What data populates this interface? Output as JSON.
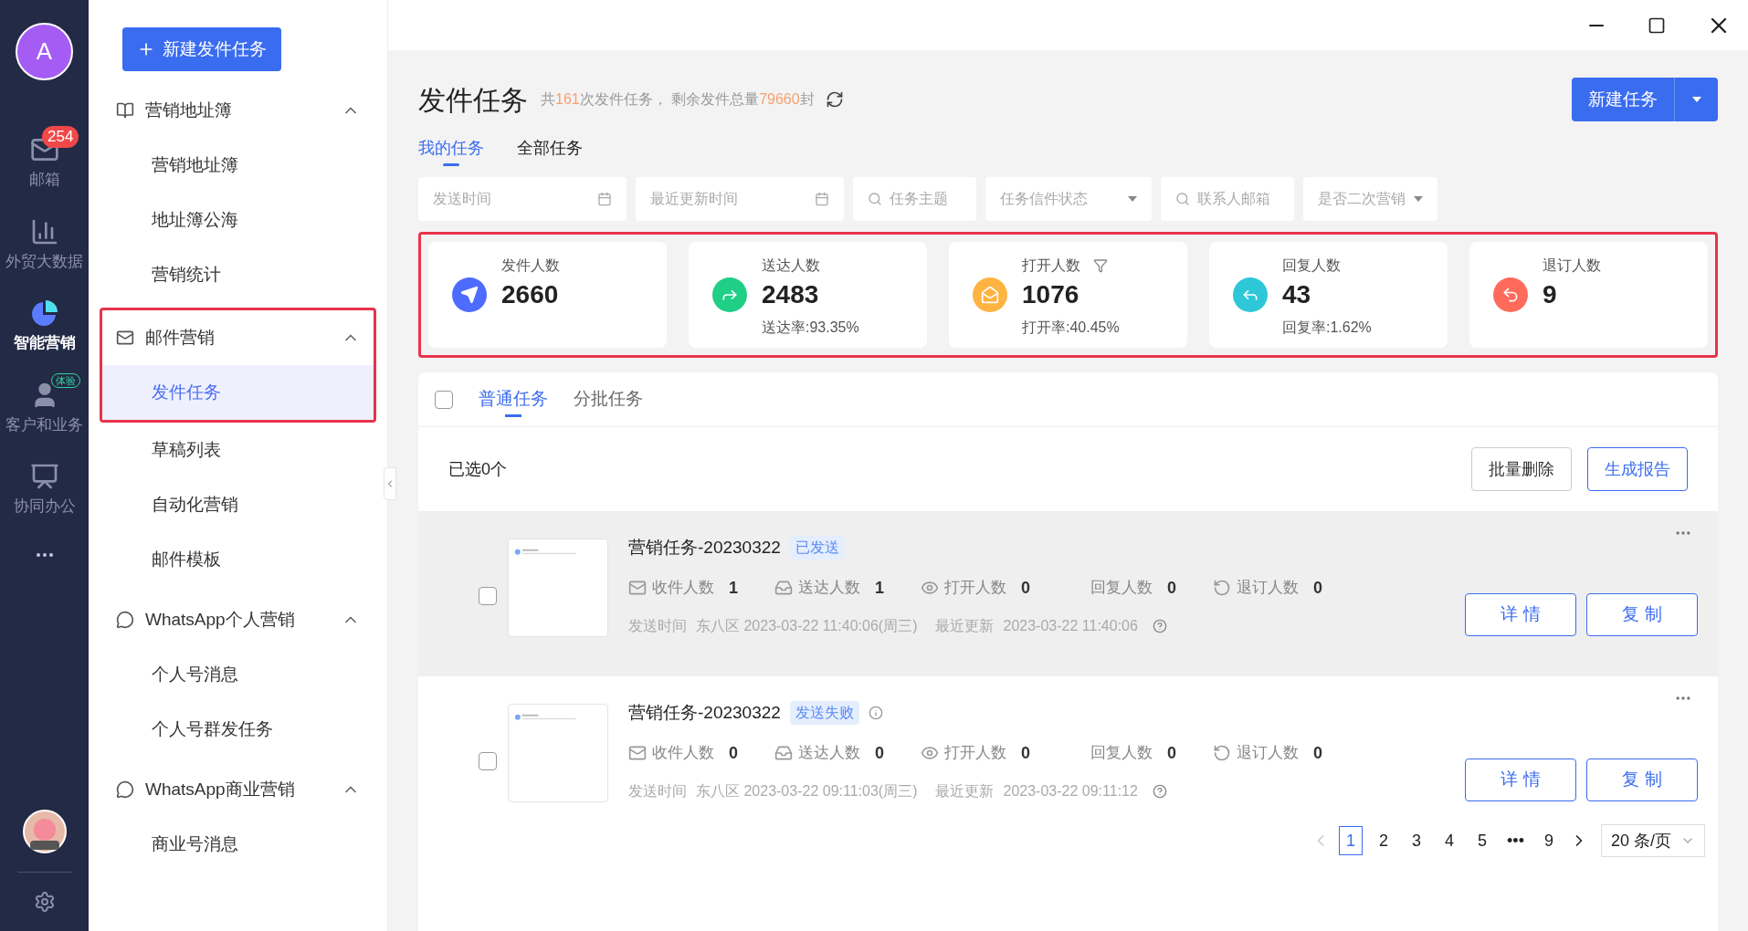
{
  "rail": {
    "avatar_letter": "A",
    "items": [
      {
        "kind": "mail",
        "label": "邮箱",
        "badge": "254",
        "selected": false
      },
      {
        "kind": "data",
        "label": "外贸大数据",
        "selected": false
      },
      {
        "kind": "marketing",
        "label": "智能营销",
        "selected": true
      },
      {
        "kind": "customer",
        "label": "客户和业务",
        "tag": "体验",
        "selected": false
      },
      {
        "kind": "office",
        "label": "协同办公",
        "selected": false
      }
    ]
  },
  "sidebar": {
    "new_button": "新建发件任务",
    "groups": [
      {
        "kind": "book",
        "title": "营销地址簿",
        "expanded": true,
        "children": [
          {
            "label": "营销地址簿",
            "selected": false
          },
          {
            "label": "地址簿公海",
            "selected": false
          },
          {
            "label": "营销统计",
            "selected": false
          }
        ]
      },
      {
        "kind": "mail",
        "title": "邮件营销",
        "expanded": true,
        "highlighted": true,
        "children": [
          {
            "label": "发件任务",
            "selected": true,
            "framed": true
          },
          {
            "label": "草稿列表",
            "selected": false,
            "framed": false
          },
          {
            "label": "自动化营销",
            "selected": false,
            "framed": false
          },
          {
            "label": "邮件模板",
            "selected": false,
            "framed": false
          }
        ]
      },
      {
        "kind": "whatsapp",
        "title": "WhatsApp个人营销",
        "expanded": true,
        "children": [
          {
            "label": "个人号消息",
            "selected": false
          },
          {
            "label": "个人号群发任务",
            "selected": false
          }
        ]
      },
      {
        "kind": "whatsapp",
        "title": "WhatsApp商业营销",
        "expanded": true,
        "children": [
          {
            "label": "商业号消息",
            "selected": false
          }
        ]
      }
    ]
  },
  "header": {
    "title": "发件任务",
    "summary": [
      {
        "text": "共",
        "accent": false
      },
      {
        "text": "161",
        "accent": true
      },
      {
        "text": "次发件任务， 剩余发件总量",
        "accent": false
      },
      {
        "text": "79660",
        "accent": true
      },
      {
        "text": "封",
        "accent": false
      }
    ],
    "new_button": "新建任务"
  },
  "tabs": [
    {
      "label": "我的任务",
      "selected": true
    },
    {
      "label": "全部任务",
      "selected": false
    }
  ],
  "filters": [
    {
      "kind": "date",
      "placeholder": "发送时间"
    },
    {
      "kind": "date",
      "placeholder": "最近更新时间"
    },
    {
      "kind": "search",
      "placeholder": "任务主题"
    },
    {
      "kind": "select",
      "placeholder": "任务信件状态"
    },
    {
      "kind": "search",
      "placeholder": "联系人邮箱"
    },
    {
      "kind": "select",
      "placeholder": "是否二次营销"
    }
  ],
  "stats": {
    "highlighted": true,
    "cards": [
      {
        "kind": "send",
        "label": "发件人数",
        "value": "2660",
        "color": "#4d6bfe",
        "filter": false
      },
      {
        "kind": "delivered",
        "label": "送达人数",
        "value": "2483",
        "rate": "送达率:93.35%",
        "color": "#1fcf86",
        "filter": false
      },
      {
        "kind": "opened",
        "label": "打开人数",
        "value": "1076",
        "rate": "打开率:40.45%",
        "color": "#ffb340",
        "filter": true
      },
      {
        "kind": "replied",
        "label": "回复人数",
        "value": "43",
        "rate": "回复率:1.62%",
        "color": "#2ec7d8",
        "filter": false
      },
      {
        "kind": "unsubscribed",
        "label": "退订人数",
        "value": "9",
        "color": "#ff6b5b",
        "filter": false
      }
    ]
  },
  "panel": {
    "checked_all": false,
    "tabs": [
      {
        "label": "普通任务",
        "selected": true
      },
      {
        "label": "分批任务",
        "selected": false
      }
    ],
    "selected_count": "已选0个",
    "buttons": [
      {
        "kind": "default",
        "label": "批量删除"
      },
      {
        "kind": "primary",
        "label": "生成报告"
      }
    ],
    "tasks": [
      {
        "title": "营销任务-20230322",
        "status": "已发送",
        "failed": false,
        "hovered": true,
        "checked": false,
        "metrics": [
          {
            "kind": "received",
            "label": "收件人数",
            "value": "1"
          },
          {
            "kind": "delivered",
            "label": "送达人数",
            "value": "1"
          },
          {
            "kind": "opened",
            "label": "打开人数",
            "value": "0"
          },
          {
            "kind": "replied",
            "label": "回复人数",
            "value": "0"
          },
          {
            "kind": "unsubscribed",
            "label": "退订人数",
            "value": "0"
          }
        ],
        "send_label": "发送时间",
        "send_time": "东八区 2023-03-22 11:40:06(周三)",
        "update_label": "最近更新",
        "update_time": "2023-03-22 11:40:06",
        "buttons": [
          "详 情",
          "复 制"
        ]
      },
      {
        "title": "营销任务-20230322",
        "status": "发送失败",
        "failed": true,
        "hovered": false,
        "checked": false,
        "metrics": [
          {
            "kind": "received",
            "label": "收件人数",
            "value": "0"
          },
          {
            "kind": "delivered",
            "label": "送达人数",
            "value": "0"
          },
          {
            "kind": "opened",
            "label": "打开人数",
            "value": "0"
          },
          {
            "kind": "replied",
            "label": "回复人数",
            "value": "0"
          },
          {
            "kind": "unsubscribed",
            "label": "退订人数",
            "value": "0"
          }
        ],
        "send_label": "发送时间",
        "send_time": "东八区 2023-03-22 09:11:03(周三)",
        "update_label": "最近更新",
        "update_time": "2023-03-22 09:11:12",
        "buttons": [
          "详 情",
          "复 制"
        ]
      }
    ],
    "pagination": {
      "pages": [
        {
          "label": "1",
          "selected": true
        },
        {
          "label": "2",
          "selected": false
        },
        {
          "label": "3",
          "selected": false
        },
        {
          "label": "4",
          "selected": false
        },
        {
          "label": "5",
          "selected": false
        },
        {
          "label": "•••",
          "selected": false
        },
        {
          "label": "9",
          "selected": false
        }
      ],
      "page_size": "20 条/页"
    }
  }
}
